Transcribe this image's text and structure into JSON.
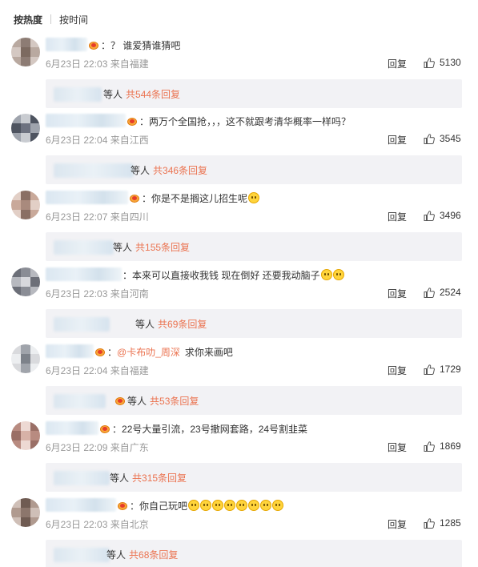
{
  "tabs": {
    "hot": "按热度",
    "time": "按时间"
  },
  "reply_label": "回复",
  "sub_suffix_pre": "等人",
  "comments": [
    {
      "text": "？ 谁爱猜谁猜吧",
      "mention": "",
      "emoji_count": 0,
      "meta": "6月23日 22:03 来自福建",
      "likes": "5130",
      "sub": "共544条回复"
    },
    {
      "text": "两万个全国抢，，，这不就跟考清华概率一样吗？",
      "mention": "",
      "emoji_count": 0,
      "meta": "6月23日 22:04 来自江西",
      "likes": "3545",
      "sub": "共346条回复"
    },
    {
      "text": "你是不是搁这儿招生呢",
      "mention": "",
      "emoji_count": 1,
      "meta": "6月23日 22:07 来自四川",
      "likes": "3496",
      "sub": "共155条回复"
    },
    {
      "text": "本来可以直接收我钱 现在倒好 还要我动脑子",
      "mention": "",
      "emoji_count": 2,
      "meta": "6月23日 22:03 来自河南",
      "likes": "2524",
      "sub": "共69条回复"
    },
    {
      "text": "求你来画吧",
      "mention": "@卡布叻_周深",
      "emoji_count": 0,
      "meta": "6月23日 22:04 来自福建",
      "likes": "1729",
      "sub": "共53条回复"
    },
    {
      "text": "22号大量引流，23号撤网套路，24号割韭菜",
      "mention": "",
      "emoji_count": 0,
      "meta": "6月23日 22:09 来自广东",
      "likes": "1869",
      "sub": "共315条回复"
    },
    {
      "text": "你自己玩吧",
      "mention": "",
      "emoji_count": 8,
      "meta": "6月23日 22:03 来自北京",
      "likes": "1285",
      "sub": "共68条回复"
    }
  ],
  "colors": {
    "accent": "#eb7350",
    "meta": "#999999",
    "sub_bg": "#f2f2f5"
  }
}
